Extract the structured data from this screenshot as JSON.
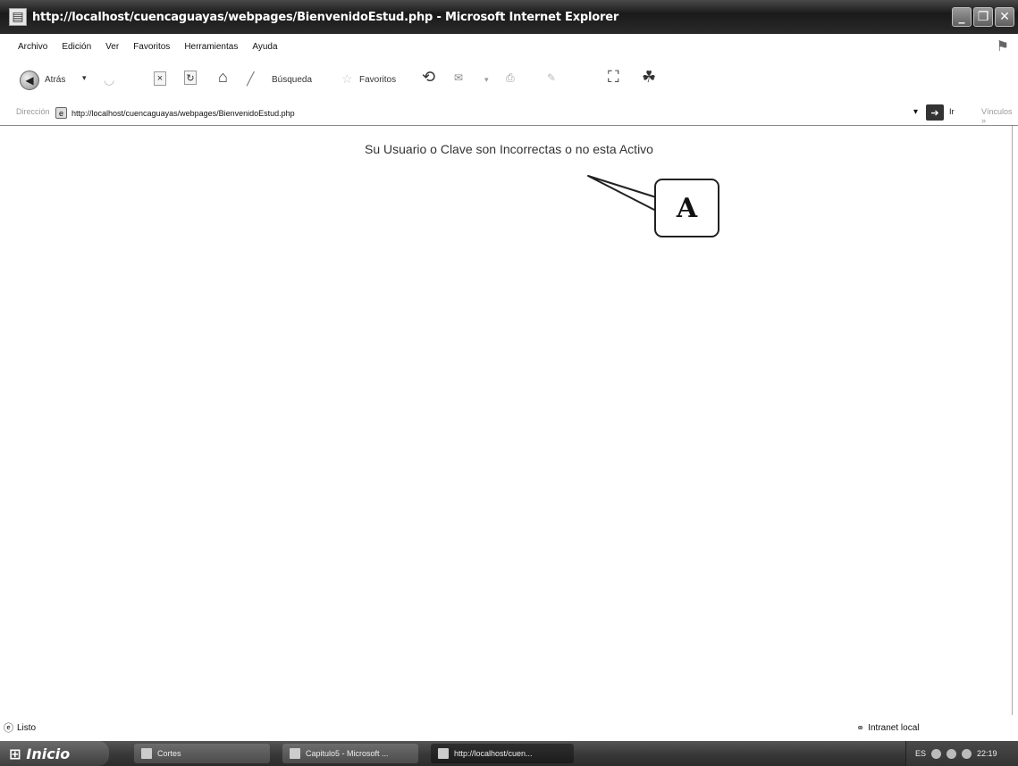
{
  "window": {
    "title": "http://localhost/cuencaguayas/webpages/BienvenidoEstud.php - Microsoft Internet Explorer"
  },
  "menu": {
    "items": [
      "Archivo",
      "Edición",
      "Ver",
      "Favoritos",
      "Herramientas",
      "Ayuda"
    ]
  },
  "toolbar": {
    "back_label": "Atrás",
    "search_label": "Búsqueda",
    "favorites_label": "Favoritos"
  },
  "address": {
    "url": "http://localhost/cuencaguayas/webpages/BienvenidoEstud.php",
    "go_label": "Ir"
  },
  "page": {
    "message": "Su Usuario o Clave son Incorrectas o no esta Activo"
  },
  "callout": {
    "label": "A"
  },
  "status": {
    "text": "Listo",
    "zone": "Intranet local"
  },
  "taskbar": {
    "start_label": "Inicio",
    "tasks": [
      "Cortes",
      "Capitulo5 - Microsoft ...",
      "http://localhost/cuen..."
    ],
    "language": "ES",
    "clock": "22:19"
  }
}
